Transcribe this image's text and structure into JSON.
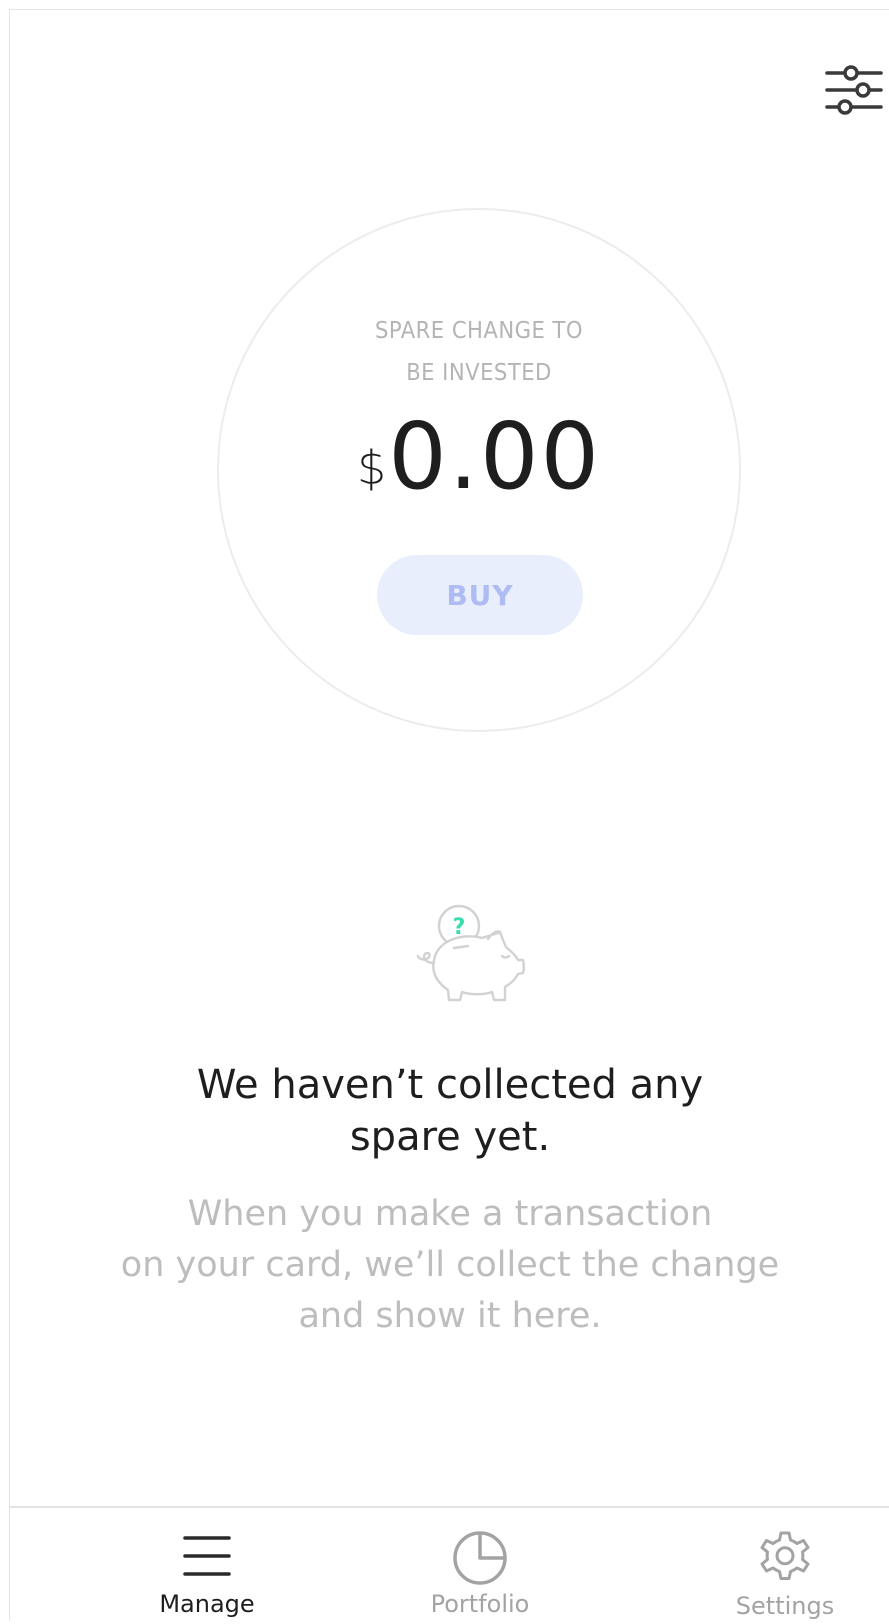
{
  "header": {
    "filter_icon": "sliders-icon"
  },
  "summary": {
    "label_line1": "SPARE CHANGE TO",
    "label_line2": "BE INVESTED",
    "currency": "$",
    "amount": "0.00",
    "buy_label": "BUY"
  },
  "empty_state": {
    "icon": "piggy-bank-question-icon",
    "icon_glyph": "?",
    "title_line1": "We haven’t collected any",
    "title_line2": "spare yet.",
    "desc_line1": "When you make a transaction",
    "desc_line2": "on your card, we’ll collect the change",
    "desc_line3": "and show it here."
  },
  "tabbar": {
    "tabs": [
      {
        "label": "Manage",
        "icon": "menu-icon",
        "active": true
      },
      {
        "label": "Portfolio",
        "icon": "pie-chart-icon",
        "active": false
      },
      {
        "label": "Settings",
        "icon": "gear-icon",
        "active": false
      }
    ]
  },
  "colors": {
    "text_primary": "#1e1e1e",
    "text_muted": "#bdbdbd",
    "buy_bg": "#e9eefd",
    "buy_text": "#aebcf3",
    "accent_green": "#3ddbb0",
    "icon_gray": "#a3a3a3"
  }
}
